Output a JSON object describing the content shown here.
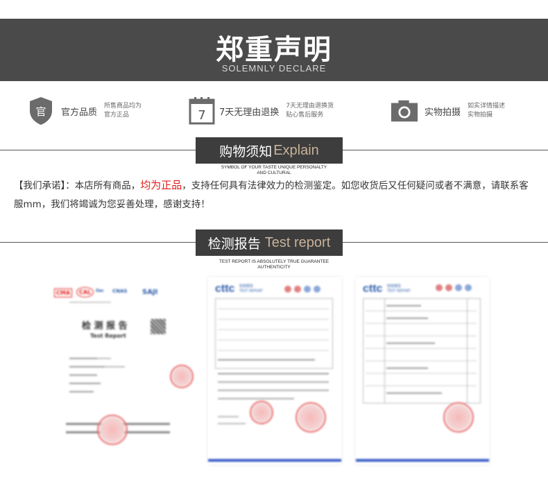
{
  "banner": {
    "title": "郑重声明",
    "subtitle": "SOLEMNLY DECLARE"
  },
  "features": [
    {
      "icon": "shield-icon",
      "icon_text": "官",
      "label": "官方品质",
      "desc1": "所售商品均为",
      "desc2": "官方正品"
    },
    {
      "icon": "calendar-icon",
      "icon_text": "7",
      "label": "7天无理由退换",
      "desc1": "7天无理由退换货",
      "desc2": "贴心售后服务"
    },
    {
      "icon": "camera-icon",
      "label": "实物拍摄",
      "desc1": "如实详情描述",
      "desc2": "实物拍摄"
    }
  ],
  "section1": {
    "title_cn": "购物须知",
    "title_en": "Explain",
    "sub1": "SYMBOL OF YOUR TASTE UNIQUE PERSONALTY",
    "sub2": "AND CULTURAL"
  },
  "notice": {
    "part1": "【我们承诺】：本店所有商品，",
    "highlight": "均为正品",
    "part2": "，支持任何具有法律效力的检测鉴定。如您收货后又任何疑问或者不满意，请联系客服mm，我们将竭诚为您妥善处理，感谢支持！"
  },
  "section2": {
    "title_cn": "检测报告",
    "title_en": "Test report",
    "sub1": "TEST REPORT IS ABSOLUTELY TRUE GUARANTEE",
    "sub2": "AUTHENTICITY"
  },
  "documents": [
    {
      "title_cn": "检 测 报 告",
      "title_en": "Test Report",
      "logos": [
        "CMA",
        "CAL",
        "ilac",
        "CNAS",
        "SAJI"
      ]
    },
    {
      "brand": "cttc",
      "brand_sub": "检验报告",
      "brand_en": "TEST REPORT"
    },
    {
      "brand": "cttc",
      "brand_sub": "检验报告",
      "brand_en": "TEST REPORT"
    }
  ],
  "colors": {
    "banner_bg": "#4a4a4a",
    "section_bg": "#3d3d3d",
    "accent_en": "#c8b39a",
    "highlight": "#e0201a",
    "icon_gray": "#6b6b6b"
  }
}
